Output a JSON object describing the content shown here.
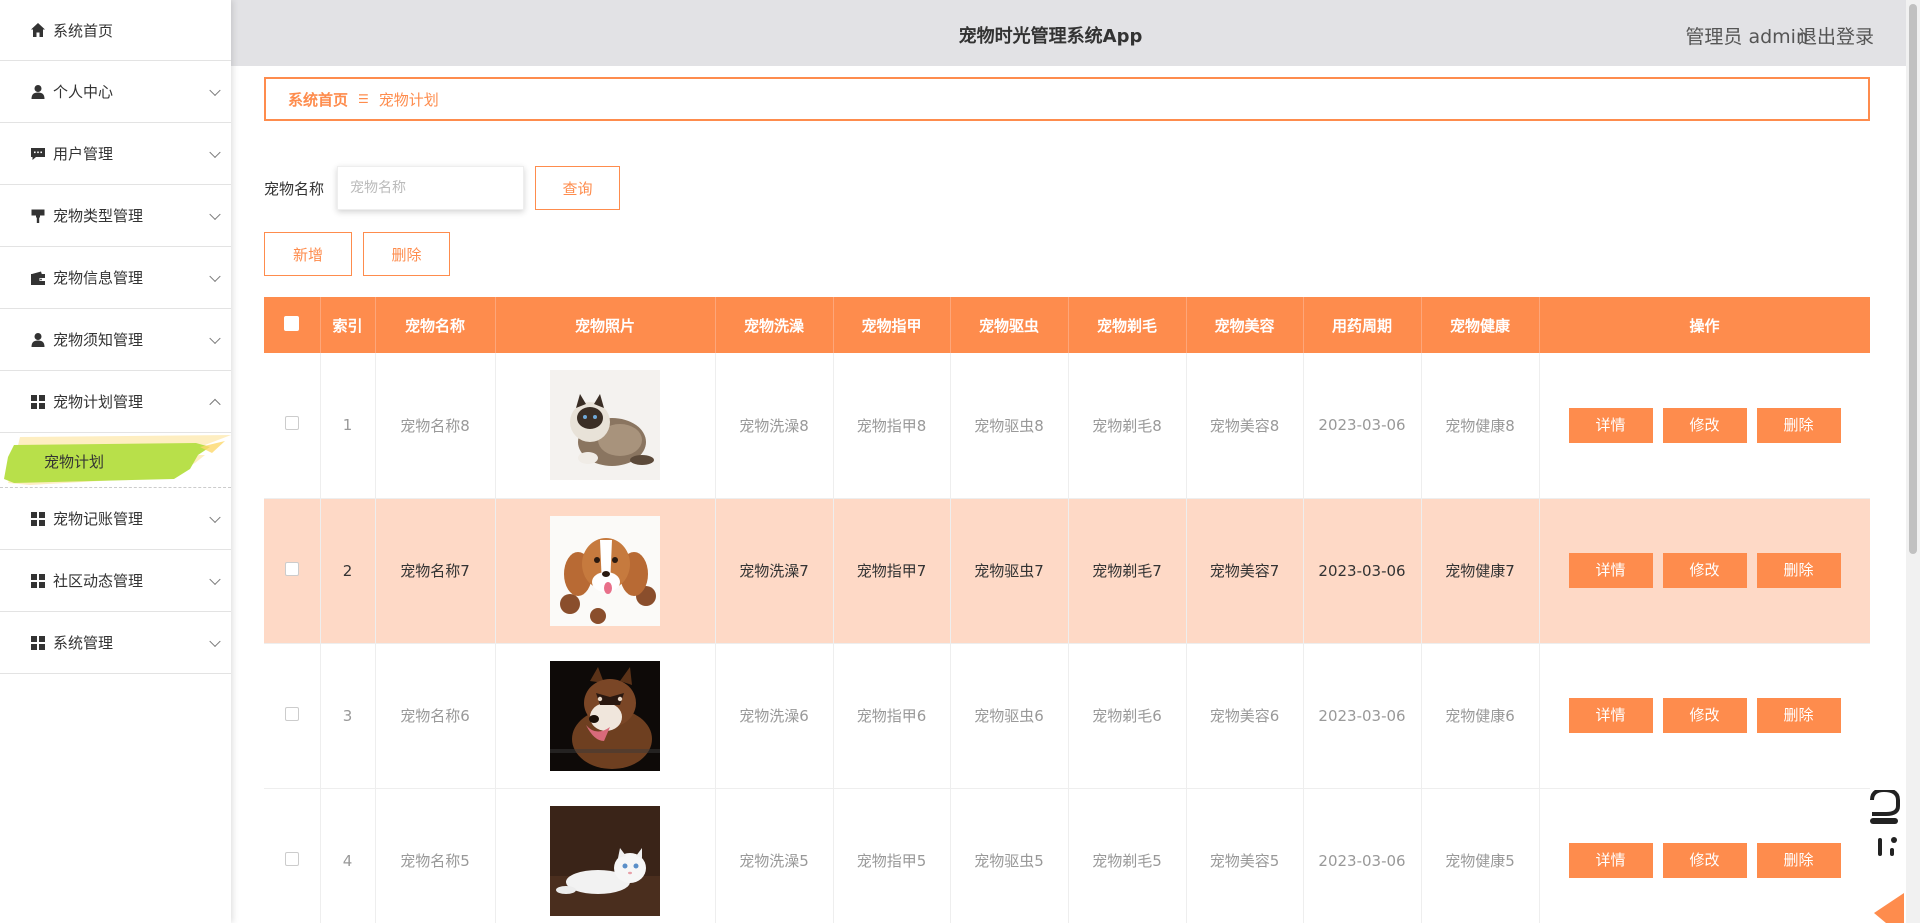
{
  "app_title": "宠物时光管理系统App",
  "header": {
    "user_text": "管理员 admin",
    "logout_label": "退出登录"
  },
  "sidebar": {
    "items": [
      {
        "label": "系统首页",
        "icon": "home-icon"
      },
      {
        "label": "个人中心",
        "icon": "person-icon"
      },
      {
        "label": "用户管理",
        "icon": "chat-icon"
      },
      {
        "label": "宠物类型管理",
        "icon": "brush-icon"
      },
      {
        "label": "宠物信息管理",
        "icon": "wallet-icon"
      },
      {
        "label": "宠物须知管理",
        "icon": "person-icon"
      },
      {
        "label": "宠物计划管理",
        "icon": "grid-icon"
      },
      {
        "label": "宠物记账管理",
        "icon": "grid-icon"
      },
      {
        "label": "社区动态管理",
        "icon": "grid-icon"
      },
      {
        "label": "系统管理",
        "icon": "grid-icon"
      }
    ],
    "active_sub": "宠物计划"
  },
  "breadcrumb": {
    "home": "系统首页",
    "separator": "☰",
    "current": "宠物计划"
  },
  "search": {
    "label": "宠物名称",
    "placeholder": "宠物名称",
    "query_button": "查询"
  },
  "actions": {
    "add_button": "新增",
    "delete_button": "删除"
  },
  "table": {
    "columns": [
      "索引",
      "宠物名称",
      "宠物照片",
      "宠物洗澡",
      "宠物指甲",
      "宠物驱虫",
      "宠物剃毛",
      "宠物美容",
      "用药周期",
      "宠物健康",
      "操作"
    ],
    "rows": [
      {
        "index": "1",
        "name": "宠物名称8",
        "photo": "cat-photo",
        "bath": "宠物洗澡8",
        "nail": "宠物指甲8",
        "deworm": "宠物驱虫8",
        "shave": "宠物剃毛8",
        "beauty": "宠物美容8",
        "period": "2023-03-06",
        "health": "宠物健康8"
      },
      {
        "index": "2",
        "name": "宠物名称7",
        "photo": "spaniel-photo",
        "bath": "宠物洗澡7",
        "nail": "宠物指甲7",
        "deworm": "宠物驱虫7",
        "shave": "宠物剃毛7",
        "beauty": "宠物美容7",
        "period": "2023-03-06",
        "health": "宠物健康7"
      },
      {
        "index": "3",
        "name": "宠物名称6",
        "photo": "malamute-photo",
        "bath": "宠物洗澡6",
        "nail": "宠物指甲6",
        "deworm": "宠物驱虫6",
        "shave": "宠物剃毛6",
        "beauty": "宠物美容6",
        "period": "2023-03-06",
        "health": "宠物健康6"
      },
      {
        "index": "4",
        "name": "宠物名称5",
        "photo": "white-cat-photo",
        "bath": "宠物洗澡5",
        "nail": "宠物指甲5",
        "deworm": "宠物驱虫5",
        "shave": "宠物剃毛5",
        "beauty": "宠物美容5",
        "period": "2023-03-06",
        "health": "宠物健康5"
      }
    ],
    "row_actions": {
      "detail": "详情",
      "edit": "修改",
      "delete": "删除"
    }
  },
  "colors": {
    "accent": "#fe8c4d",
    "highlight_row": "#fed9c6",
    "active_sub_bg": "#b8e04a",
    "header_bg": "#e2e2e5"
  }
}
